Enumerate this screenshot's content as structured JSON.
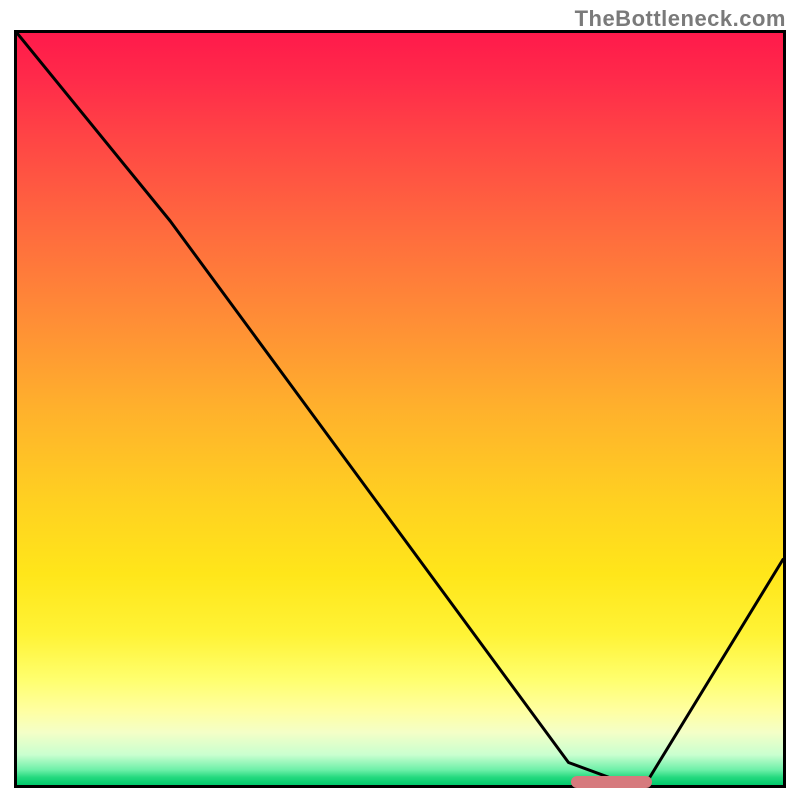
{
  "watermark": "TheBottleneck.com",
  "chart_data": {
    "type": "line",
    "title": "",
    "xlabel": "",
    "ylabel": "",
    "xlim": [
      0,
      100
    ],
    "ylim": [
      0,
      100
    ],
    "grid": false,
    "legend": false,
    "series": [
      {
        "name": "curve",
        "x": [
          0,
          20,
          72,
          80,
          82,
          100
        ],
        "values": [
          100,
          75,
          3,
          0,
          0,
          30
        ]
      }
    ],
    "marker": {
      "x_start": 72,
      "x_end": 82,
      "y": 0
    },
    "background_gradient": {
      "stops": [
        {
          "pct": 0,
          "color": "#ff1a4b"
        },
        {
          "pct": 50,
          "color": "#ffb12c"
        },
        {
          "pct": 86,
          "color": "#ffffa0"
        },
        {
          "pct": 100,
          "color": "#00c96b"
        }
      ]
    }
  }
}
